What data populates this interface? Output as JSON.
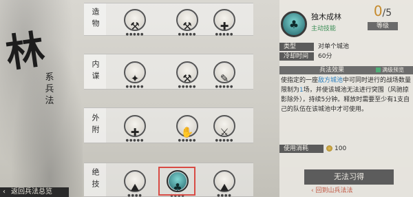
{
  "left": {
    "char": "林",
    "title": "系兵法",
    "back_label": "返回兵法总览"
  },
  "rows": [
    {
      "label": "造物",
      "skills": [
        {
          "icon": "hammer-icon",
          "glyph": "⚒",
          "stars": "●●●●●"
        },
        {
          "icon": "hammer-icon",
          "glyph": "⚒",
          "stars": "●●●●●"
        },
        {
          "icon": "wand-icon",
          "glyph": "✚",
          "stars": "●●●●●"
        }
      ]
    },
    {
      "label": "内谍",
      "skills": [
        {
          "icon": "figure-icon",
          "glyph": "✦",
          "stars": "●●●●●"
        },
        {
          "icon": "hammer-icon",
          "glyph": "⚒",
          "stars": "●●●●●"
        },
        {
          "icon": "scroll-icon",
          "glyph": "✎",
          "stars": "●●●●●"
        }
      ]
    },
    {
      "label": "外附",
      "skills": [
        {
          "icon": "plus-icon",
          "glyph": "✚",
          "stars": "●●●●●"
        },
        {
          "icon": "hand-icon",
          "glyph": "✋",
          "stars": "●●●●●"
        },
        {
          "icon": "soldiers-icon",
          "glyph": "⚔",
          "stars": "●●●●●"
        }
      ]
    },
    {
      "label": "绝技",
      "skills": [
        {
          "icon": "rock-icon",
          "glyph": "⛰",
          "stars": "●●●●"
        },
        {
          "icon": "tree-icon",
          "glyph": "♣",
          "stars": "●●●●"
        },
        {
          "icon": "mountain-icon",
          "glyph": "⛰",
          "stars": "●●●●"
        }
      ]
    }
  ],
  "detail": {
    "name": "独木成林",
    "type": "主动技能",
    "level_current": "0",
    "level_max": "/5",
    "level_label": "等级",
    "kind_label": "类型",
    "kind_value": "对单个城池",
    "cd_label": "冷却时间",
    "cd_value": "60分",
    "effect_label": "兵法效果",
    "preview_label": "满级预览",
    "effect_text_1": "使指定的一座",
    "effect_hl_1": "敌方城池",
    "effect_text_2": "中可同时进行的战场数量限制为",
    "effect_hl_2": "1",
    "effect_text_3": "场，并使该城池无法进行突围（风驰掠影除外），持续5分钟。释放时需要至少有1支自己的队伍在该城池中才可使用。",
    "cost_label": "使用消耗",
    "cost_value": "100",
    "learn_button": "无法习得",
    "return_link": "回到山兵法法"
  },
  "colors": {
    "accent_red": "#d84a43",
    "skill_teal": "#2a7f86",
    "active_green": "#3c8f57",
    "link_blue": "#2c7fbf"
  }
}
